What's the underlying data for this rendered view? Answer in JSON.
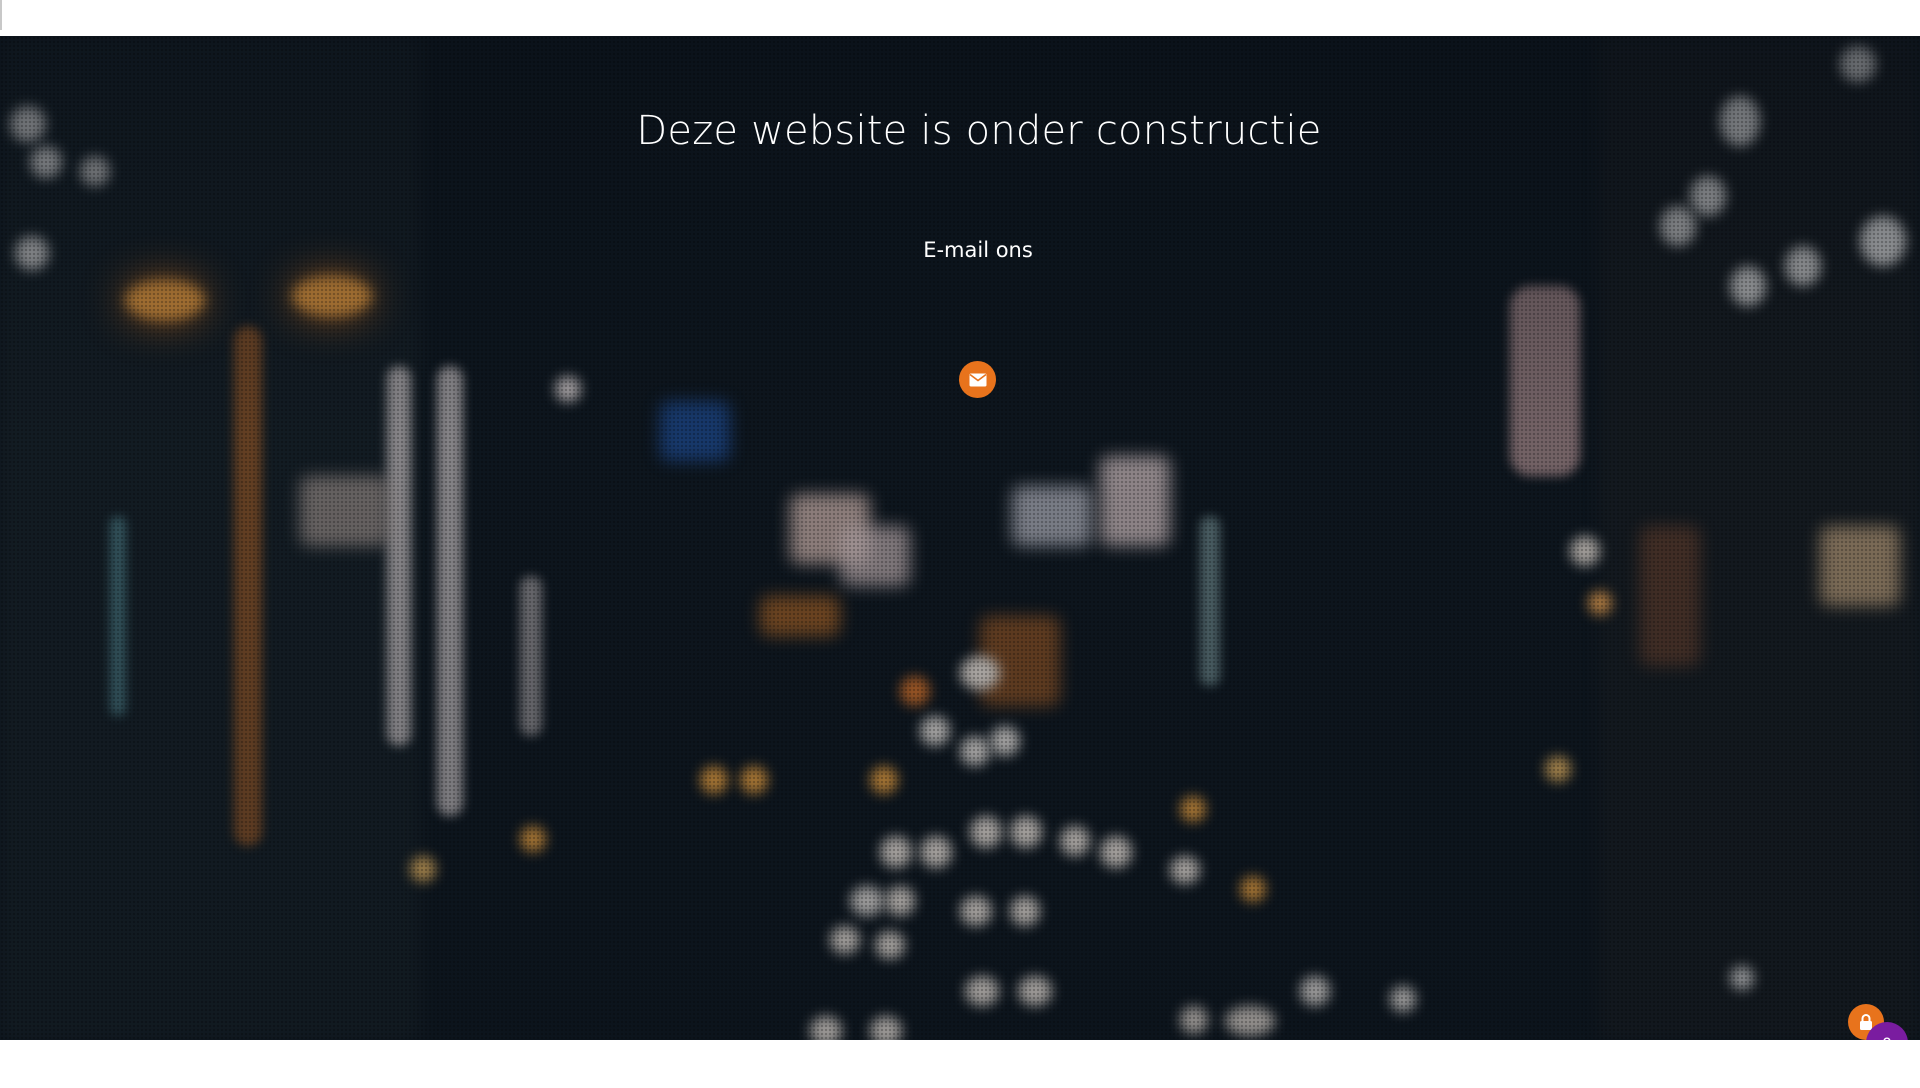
{
  "page": {
    "title": "Deze website is onder constructie",
    "contact_label": "E-mail ons"
  },
  "icons": {
    "mail": "envelope-icon",
    "lock": "lock-icon"
  },
  "widget": {
    "count": "0"
  },
  "colors": {
    "accent_orange": "#e8731c",
    "badge_purple": "#7a1ca0",
    "text": "#ffffff"
  }
}
